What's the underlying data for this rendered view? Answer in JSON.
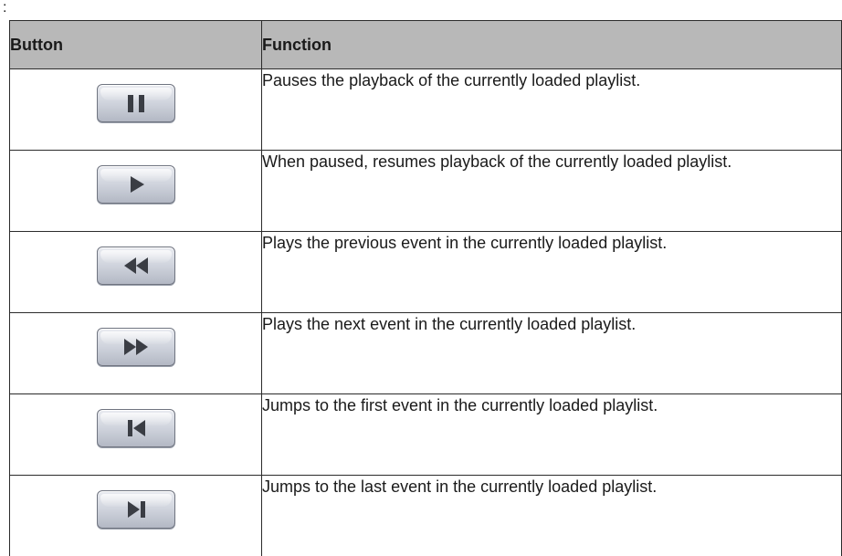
{
  "leading_text": ":",
  "table": {
    "headers": {
      "button": "Button",
      "function": "Function"
    },
    "rows": [
      {
        "icon": "pause-icon",
        "description": "Pauses the playback of the currently loaded playlist."
      },
      {
        "icon": "play-icon",
        "description": "When paused, resumes playback of the currently loaded playlist."
      },
      {
        "icon": "rewind-icon",
        "description": "Plays the previous event in the currently loaded playlist."
      },
      {
        "icon": "fast-forward-icon",
        "description": "Plays the next event in the currently loaded playlist."
      },
      {
        "icon": "skip-to-start-icon",
        "description": "Jumps to the first event in the currently loaded playlist."
      },
      {
        "icon": "skip-to-end-icon",
        "description": "Jumps to the last event in the currently loaded playlist."
      }
    ]
  },
  "colors": {
    "header_background": "#b8b8b8",
    "glyph": "#3a3d44",
    "border": "#2b2b2b"
  }
}
